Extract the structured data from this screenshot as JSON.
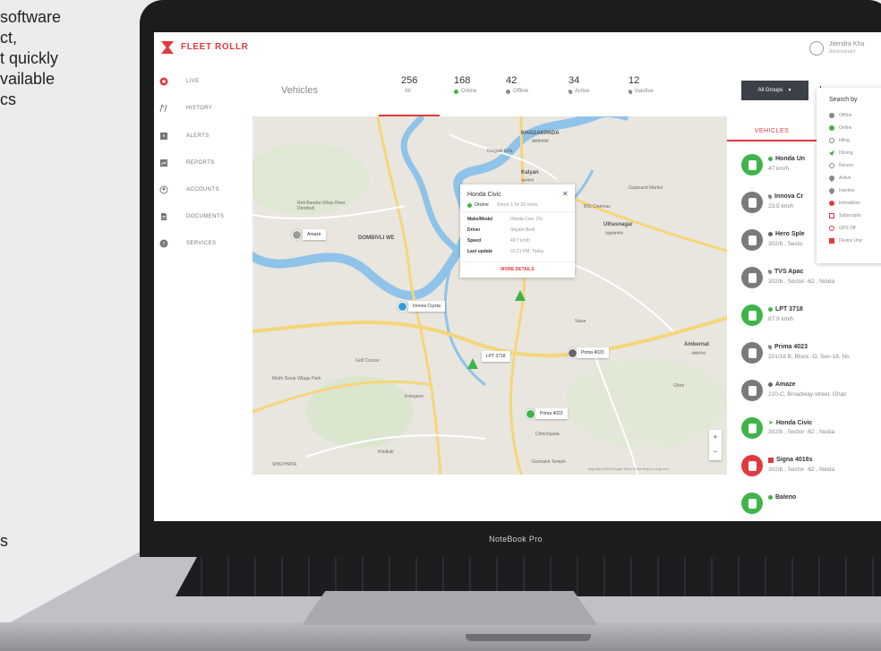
{
  "background_copy": {
    "lines": [
      "software",
      "ct,",
      "t quickly",
      "vailable",
      "cs"
    ],
    "bottom": "s"
  },
  "device": {
    "label": "NoteBook Pro"
  },
  "app": {
    "brand": "FLEET ROLLR",
    "accent": "#e03a3e",
    "user": {
      "name": "Jitendra Kha",
      "role": "Administrator"
    }
  },
  "sidebar": {
    "items": [
      {
        "label": "LIVE",
        "icon": "live-icon",
        "active": true
      },
      {
        "label": "HISTORY",
        "icon": "history-icon"
      },
      {
        "label": "ALERTS",
        "icon": "alerts-icon"
      },
      {
        "label": "REPORTS",
        "icon": "reports-icon"
      },
      {
        "label": "ACCOUNTS",
        "icon": "accounts-icon"
      },
      {
        "label": "DOCUMENTS",
        "icon": "documents-icon"
      },
      {
        "label": "SERVICES",
        "icon": "services-icon"
      }
    ]
  },
  "header": {
    "title": "Vehicles",
    "stats": [
      {
        "value": "256",
        "label": "All",
        "marker": "none"
      },
      {
        "value": "168",
        "label": "Online",
        "marker": "green-dot"
      },
      {
        "value": "42",
        "label": "Offline",
        "marker": "grey-dot"
      },
      {
        "value": "34",
        "label": "Active",
        "marker": "pin"
      },
      {
        "value": "12",
        "label": "Inactive",
        "marker": "pin"
      }
    ],
    "groups_button": "All Groups"
  },
  "search_by": {
    "title": "Search by",
    "items": [
      {
        "label": "Offline",
        "color": "#888888"
      },
      {
        "label": "Online",
        "color": "#3fb44a"
      },
      {
        "label": "Idling",
        "color": "#888888"
      },
      {
        "label": "Driving",
        "color": "#3fb44a"
      },
      {
        "label": "Recent",
        "color": "#888888"
      },
      {
        "label": "Active",
        "color": "#888888"
      },
      {
        "label": "Inactive",
        "color": "#888888"
      },
      {
        "label": "Immobilize",
        "color": "#e03a3e"
      },
      {
        "label": "Subscriptio",
        "color": "#e03a3e"
      },
      {
        "label": "GPS Off",
        "color": "#e03a3e"
      },
      {
        "label": "Device Unp",
        "color": "#e03a3e"
      }
    ]
  },
  "vehicle_panel": {
    "tab": "VEHICLES",
    "items": [
      {
        "name": "Honda Un",
        "sub": "47 km/h",
        "status": "online",
        "color": "#3fb44a"
      },
      {
        "name": "Innova Cr",
        "sub": "23.5 km/h",
        "status": "pin",
        "color": "#7a7a7a"
      },
      {
        "name": "Hero Sple",
        "sub": "302/b , Secto",
        "status": "offline",
        "color": "#7a7a7a"
      },
      {
        "name": "TVS Apac",
        "sub": "302/b , Sector -62 , Noida",
        "status": "pin",
        "color": "#7a7a7a"
      },
      {
        "name": "LPT 3718",
        "sub": "87.9 km/h",
        "status": "online",
        "color": "#3fb44a"
      },
      {
        "name": "Prima 4023",
        "sub": "201/16 B, Block -O, Sec-18, No",
        "status": "pin",
        "color": "#7a7a7a"
      },
      {
        "name": "Amaze",
        "sub": "210-C, Broadway street, Ghaz",
        "status": "offline",
        "color": "#7a7a7a"
      },
      {
        "name": "Honda Civic",
        "sub": "302/b , Sector -62 , Noida",
        "status": "driving",
        "color": "#3fb44a"
      },
      {
        "name": "Signa 4018s",
        "sub": "302/b , Sector -62 , Noida",
        "status": "alert",
        "color": "#e03a3e"
      },
      {
        "name": "Baleno",
        "sub": "",
        "status": "online",
        "color": "#3fb44a"
      }
    ]
  },
  "map": {
    "popup": {
      "title": "Honda Civic",
      "status": "Online",
      "since": "Since 1 hr 20 mins",
      "rows": [
        {
          "key": "Make/Model",
          "value": "Honda Civic ZXi"
        },
        {
          "key": "Driver",
          "value": "Shyam Bedi"
        },
        {
          "key": "Speed",
          "value": "40.7 km/h"
        },
        {
          "key": "Last update",
          "value": "01:21 PM, Today"
        }
      ],
      "more": "MORE DETAILS"
    },
    "markers": [
      {
        "label": "Amaze",
        "color": "#9a9a9a"
      },
      {
        "label": "Innova Crysta",
        "color": "#2f9fd8"
      },
      {
        "label": "LPT 3718",
        "color": "#3fb44a"
      },
      {
        "label": "Prima 4023",
        "color": "#666666"
      },
      {
        "label": "Prima 4023",
        "color": "#3fb44a"
      }
    ],
    "places": {
      "khadakpada": "KHADAKPADA",
      "khadakpada_hi": "खडकपाडा",
      "kalyan": "Kalyan",
      "kalyan_hi": "कल्याण",
      "ulhasnagar": "Ulhasnagar",
      "ulhasnagar_hi": "उल्हासनगर",
      "dombivli": "DOMBIVLI WE",
      "ambernath": "Ambernat",
      "ambernath_hi": "अंबरनाथ",
      "gajanand": "Gajanand Market",
      "big_cinemas": "BIG Cinemas",
      "durgadi": "Durgadi Killa",
      "golf": "Golf Course",
      "shilphata": "SHILPHATA",
      "gurmukh": "Gurmukh Temple",
      "mothi_desai": "Mothi Desai Village Park",
      "reti_bandar": "Reti Bandar Ulhas River Dombivli",
      "kolegaon": "Kolegaon",
      "khidkali": "Khidkali",
      "ghoti": "Ghoti",
      "vasar": "Vasar",
      "chinchpada": "Chinchpada"
    },
    "zoom_in": "+",
    "zoom_out": "−",
    "attribution": "Map data ©2018 Google   Terms of Use   Report a map error"
  }
}
